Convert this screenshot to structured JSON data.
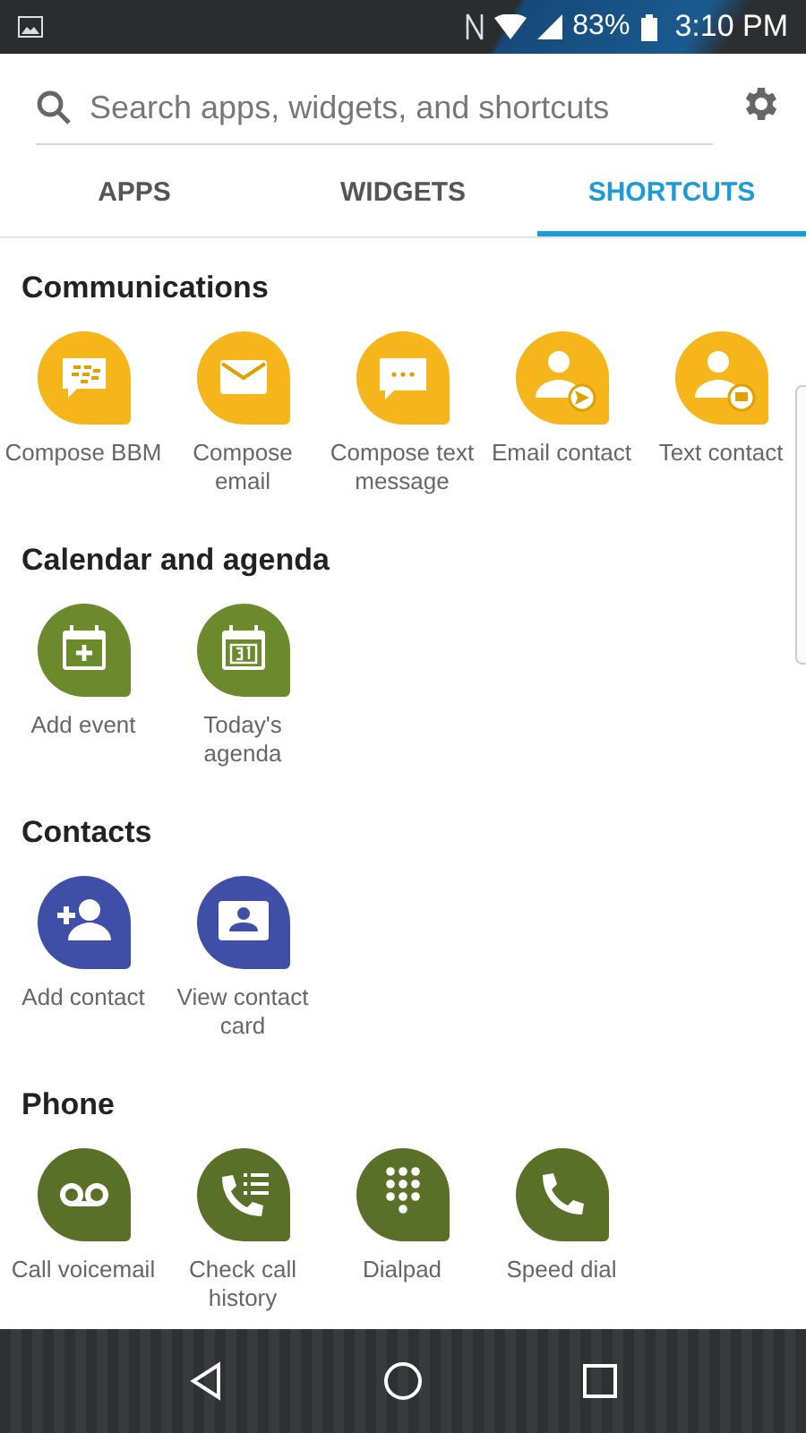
{
  "status_bar": {
    "battery": "83%",
    "time": "3:10 PM"
  },
  "search": {
    "placeholder": "Search apps, widgets, and shortcuts"
  },
  "tabs": [
    {
      "label": "APPS",
      "selected": false
    },
    {
      "label": "WIDGETS",
      "selected": false
    },
    {
      "label": "SHORTCUTS",
      "selected": true
    }
  ],
  "sections": [
    {
      "title": "Communications",
      "color": "#f5b51b",
      "items": [
        {
          "label": "Compose BBM",
          "kind": "bbm"
        },
        {
          "label": "Compose email",
          "kind": "email"
        },
        {
          "label": "Compose text message",
          "kind": "message"
        },
        {
          "label": "Email contact",
          "kind": "person-send"
        },
        {
          "label": "Text contact",
          "kind": "person-text"
        }
      ]
    },
    {
      "title": "Calendar and agenda",
      "color": "#6b8a2c",
      "items": [
        {
          "label": "Add event",
          "kind": "calendar-add"
        },
        {
          "label": "Today's agenda",
          "kind": "calendar-day"
        }
      ]
    },
    {
      "title": "Contacts",
      "color": "#3f4fa8",
      "items": [
        {
          "label": "Add contact",
          "kind": "person-add"
        },
        {
          "label": "View contact card",
          "kind": "contact-card"
        }
      ]
    },
    {
      "title": "Phone",
      "color": "#5a6f28",
      "items": [
        {
          "label": "Call voicemail",
          "kind": "voicemail"
        },
        {
          "label": "Check call history",
          "kind": "call-list"
        },
        {
          "label": "Dialpad",
          "kind": "dialpad"
        },
        {
          "label": "Speed dial",
          "kind": "phone"
        }
      ]
    }
  ]
}
